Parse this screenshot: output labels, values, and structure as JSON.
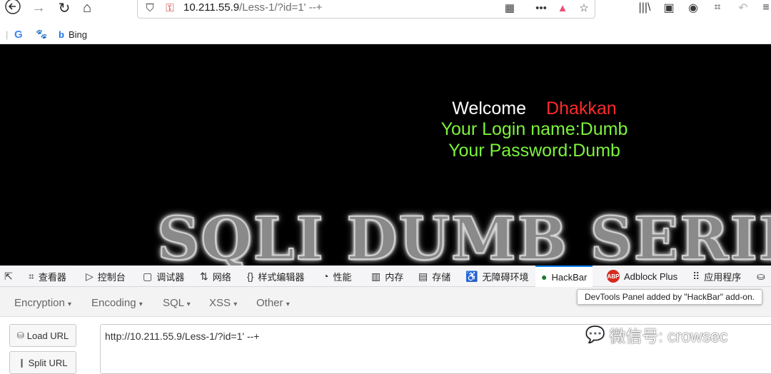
{
  "browser": {
    "url_host": "10.211.55.9",
    "url_path": "/Less-1/?id=1' --+",
    "bookmarks": [
      {
        "icon": "google-icon",
        "glyph": "G",
        "label": ""
      },
      {
        "icon": "baidu-icon",
        "glyph": "🐾",
        "label": ""
      },
      {
        "icon": "bing-icon",
        "glyph": "b",
        "label": "Bing"
      }
    ]
  },
  "page": {
    "welcome_label": "Welcome",
    "welcome_name": "Dhakkan",
    "login_line": "Your Login name:Dumb",
    "password_line": "Your Password:Dumb",
    "banner": "SQLI DUMB SERIES"
  },
  "devtools": {
    "tabs": [
      {
        "label": "查看器",
        "icon": "inspector-icon",
        "glyph": "⌗"
      },
      {
        "label": "控制台",
        "icon": "console-icon",
        "glyph": "▷"
      },
      {
        "label": "调试器",
        "icon": "debugger-icon",
        "glyph": "▢"
      },
      {
        "label": "网络",
        "icon": "network-icon",
        "glyph": "⇅"
      },
      {
        "label": "样式编辑器",
        "icon": "style-editor-icon",
        "glyph": "{}"
      },
      {
        "label": "性能",
        "icon": "performance-icon",
        "glyph": "◔"
      },
      {
        "label": "内存",
        "icon": "memory-icon",
        "glyph": "▥"
      },
      {
        "label": "存储",
        "icon": "storage-icon",
        "glyph": "▤"
      },
      {
        "label": "无障碍环境",
        "icon": "accessibility-icon",
        "glyph": "♿"
      },
      {
        "label": "HackBar",
        "icon": "hackbar-icon",
        "glyph": "●"
      },
      {
        "label": "Adblock Plus",
        "icon": "adblock-icon",
        "glyph": "ABP"
      },
      {
        "label": "应用程序",
        "icon": "application-icon",
        "glyph": "⠿"
      }
    ],
    "tooltip": "DevTools Panel added by \"HackBar\" add-on."
  },
  "hackbar": {
    "menu": [
      "Encryption",
      "Encoding",
      "SQL",
      "XSS",
      "Other"
    ],
    "load_url": "Load URL",
    "split_url": "Split URL",
    "url_value": "http://10.211.55.9/Less-1/?id=1' --+"
  },
  "watermark": "微信号: crowsec",
  "colors": {
    "welcome": "#ffffff",
    "name": "#ff2a2a",
    "credentials": "#7cf33b",
    "active_tab": "#0a84ff"
  }
}
